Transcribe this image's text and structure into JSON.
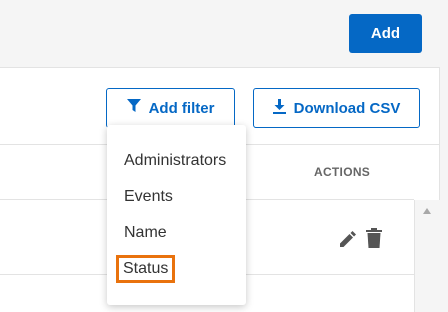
{
  "header": {
    "add_label": "Add"
  },
  "toolbar": {
    "filter_label": "Add filter",
    "csv_label": "Download CSV"
  },
  "table": {
    "actions_header": "ACTIONS"
  },
  "filter_menu": {
    "items": [
      {
        "label": "Administrators"
      },
      {
        "label": "Events"
      },
      {
        "label": "Name"
      },
      {
        "label": "Status",
        "highlighted": true
      }
    ]
  },
  "colors": {
    "primary": "#0568c5",
    "highlight": "#e9720d",
    "text": "#333333"
  },
  "icons": [
    "filter-icon",
    "download-icon",
    "edit-icon",
    "trash-icon"
  ]
}
